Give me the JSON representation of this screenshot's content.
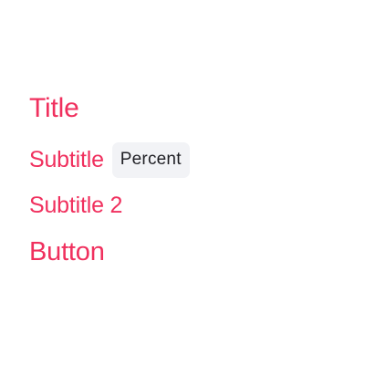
{
  "content": {
    "title": "Title",
    "subtitle": "Subtitle",
    "chip_label": "Percent",
    "subtitle2": "Subtitle 2",
    "button_label": "Button"
  },
  "colors": {
    "accent": "#f0305e",
    "chip_background": "#f2f3f6",
    "chip_text": "#1f1f24",
    "background": "#ffffff"
  }
}
